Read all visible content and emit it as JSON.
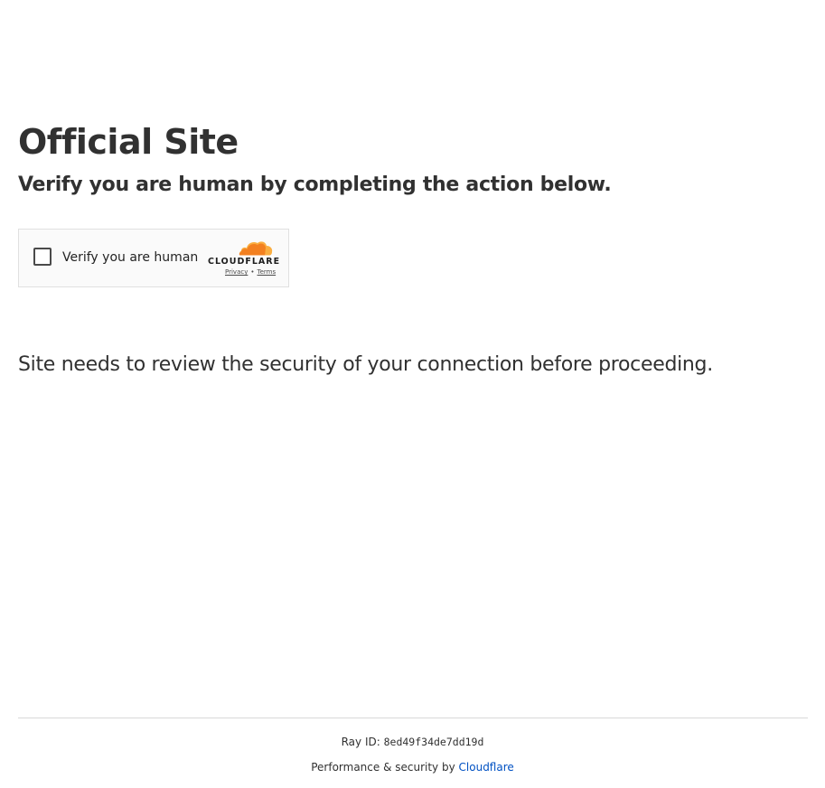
{
  "page": {
    "title": "Official Site",
    "subtitle": "Verify you are human by completing the action below.",
    "security_message": "Site needs to review the security of your connection before proceeding."
  },
  "widget": {
    "checkbox_label": "Verify you are human",
    "checked": false,
    "brand_name": "CLOUDFLARE",
    "privacy_link": "Privacy",
    "separator": "•",
    "terms_link": "Terms"
  },
  "footer": {
    "ray_label": "Ray ID:",
    "ray_id": "8ed49f34de7dd19d",
    "performance_text": "Performance & security by",
    "cloudflare_link": "Cloudflare"
  },
  "colors": {
    "text": "#313131",
    "link": "#0051c3",
    "cloud_orange": "#f38020",
    "cloud_light_orange": "#faae40"
  }
}
